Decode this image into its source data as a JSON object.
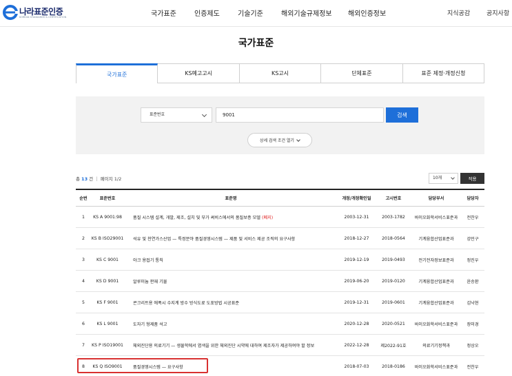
{
  "header": {
    "logo_title": "나라표준인증",
    "logo_sub": "KOREAN STANDARDS & CERTIFICATION",
    "nav": [
      "국가표준",
      "인증제도",
      "기술기준",
      "해외기술규제정보",
      "해외인증정보"
    ],
    "nav_right": [
      "지식공감",
      "공지사항"
    ]
  },
  "page_title": "국가표준",
  "tabs": [
    {
      "label": "국가표준",
      "active": true
    },
    {
      "label": "KS예고고시",
      "active": false
    },
    {
      "label": "KS고시",
      "active": false
    },
    {
      "label": "단체표준",
      "active": false
    },
    {
      "label": "표준 제정·개정신청",
      "active": false
    }
  ],
  "search": {
    "field_selected": "표준번호",
    "query": "9001",
    "button": "검색",
    "detail_toggle": "상세 검색 조건 열기"
  },
  "results": {
    "prefix": "총 ",
    "total": "13",
    "suffix": " 건 ｜ 페이지 1/2",
    "page_size": "10개",
    "apply": "적용"
  },
  "table": {
    "headers": [
      "순번",
      "표준번호",
      "표준명",
      "개정/개정확인일",
      "고시번호",
      "담당부서",
      "담당자"
    ],
    "rows": [
      {
        "no": "1",
        "code": "KS A 9001:98",
        "name": "품질 시스템 설계, 개발, 제조, 설치 및 부가 써비스에서의 품질보증 모델",
        "badge": "(폐지)",
        "date": "2003-12-31",
        "notice": "2003-1782",
        "dept": "바이오화학서비스표준과",
        "person": "전찬우"
      },
      {
        "no": "2",
        "code": "KS B ISO29001",
        "name": "석유 및 천연가스산업 — 특정분야 품질경영시스템 — 제품 및 서비스 제공 조직의 요구사항",
        "badge": "",
        "date": "2018-12-27",
        "notice": "2018-0564",
        "dept": "기계융합산업표준과",
        "person": "강민구"
      },
      {
        "no": "3",
        "code": "KS C 9001",
        "name": "아크 용접기 통칙",
        "badge": "",
        "date": "2019-12-19",
        "notice": "2019-0493",
        "dept": "전기전자정보표준과",
        "person": "정진우"
      },
      {
        "no": "4",
        "code": "KS D 9001",
        "name": "알루미늄 판재 기물",
        "badge": "",
        "date": "2019-06-20",
        "notice": "2019-0120",
        "dept": "기계융합산업표준과",
        "person": "윤승환"
      },
      {
        "no": "5",
        "code": "KS F 9001",
        "name": "콘크리트용 에폭시 수지계 방수 방식도료 도포방법 시공표준",
        "badge": "",
        "date": "2019-12-31",
        "notice": "2019-0601",
        "dept": "기계융합산업표준과",
        "person": "김낙현"
      },
      {
        "no": "6",
        "code": "KS L 9001",
        "name": "도자기 형제품 석고",
        "badge": "",
        "date": "2020-12-28",
        "notice": "2020-0521",
        "dept": "바이오화학서비스표준과",
        "person": "장미경"
      },
      {
        "no": "7",
        "code": "KS P ISO19001",
        "name": "체외진단용 의료기기 — 생물학에서 염색을 위한 체외진단 시약에 대하여 제조자가 제공하여야 할 정보",
        "badge": "",
        "date": "2022-12-28",
        "notice": "제2022-91호",
        "dept": "의료기기정책과",
        "person": "정상오"
      },
      {
        "no": "8",
        "code": "KS Q ISO9001",
        "name": "품질경영시스템 — 요구사항",
        "badge": "",
        "date": "2018-07-03",
        "notice": "2018-0186",
        "dept": "바이오화학서비스표준과",
        "person": "전찬우"
      }
    ]
  },
  "colors": {
    "accent": "#1e6fd9",
    "highlight": "#d83030",
    "badge": "#e02020"
  }
}
